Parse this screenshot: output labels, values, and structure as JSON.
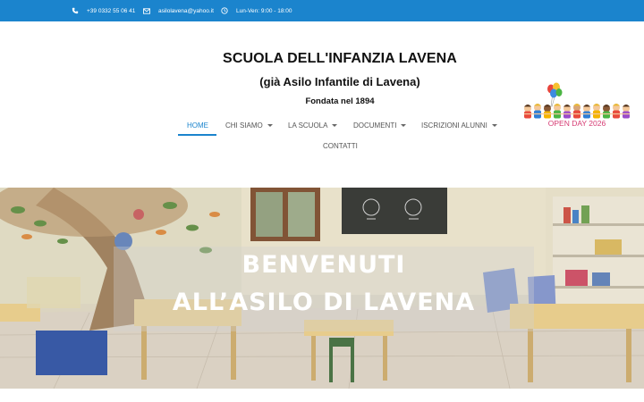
{
  "topbar": {
    "phone": "+39 0332 55 06 41",
    "email": "asilolavena@yahoo.it",
    "hours": "Lun-Ven: 9:00 - 18:00",
    "background": "#1b84cd"
  },
  "header": {
    "title": "SCUOLA DELL'INFANZIA LAVENA",
    "subtitle": "(già Asilo Infantile di Lavena)",
    "founded": "Fondata nel 1894"
  },
  "nav": {
    "items": [
      {
        "label": "HOME",
        "active": true,
        "dropdown": false
      },
      {
        "label": "CHI SIAMO",
        "active": false,
        "dropdown": true
      },
      {
        "label": "LA SCUOLA",
        "active": false,
        "dropdown": true
      },
      {
        "label": "DOCUMENTI",
        "active": false,
        "dropdown": true
      },
      {
        "label": "ISCRIZIONI ALUNNI",
        "active": false,
        "dropdown": true
      },
      {
        "label": "CONTATTI",
        "active": false,
        "dropdown": false
      }
    ],
    "accent": "#1b84cd"
  },
  "open_day": {
    "label": "OPEN DAY 2026",
    "color": "#d63b73"
  },
  "hero": {
    "line1": "BENVENUTI",
    "line2": "ALL’ASILO DI LAVENA"
  }
}
